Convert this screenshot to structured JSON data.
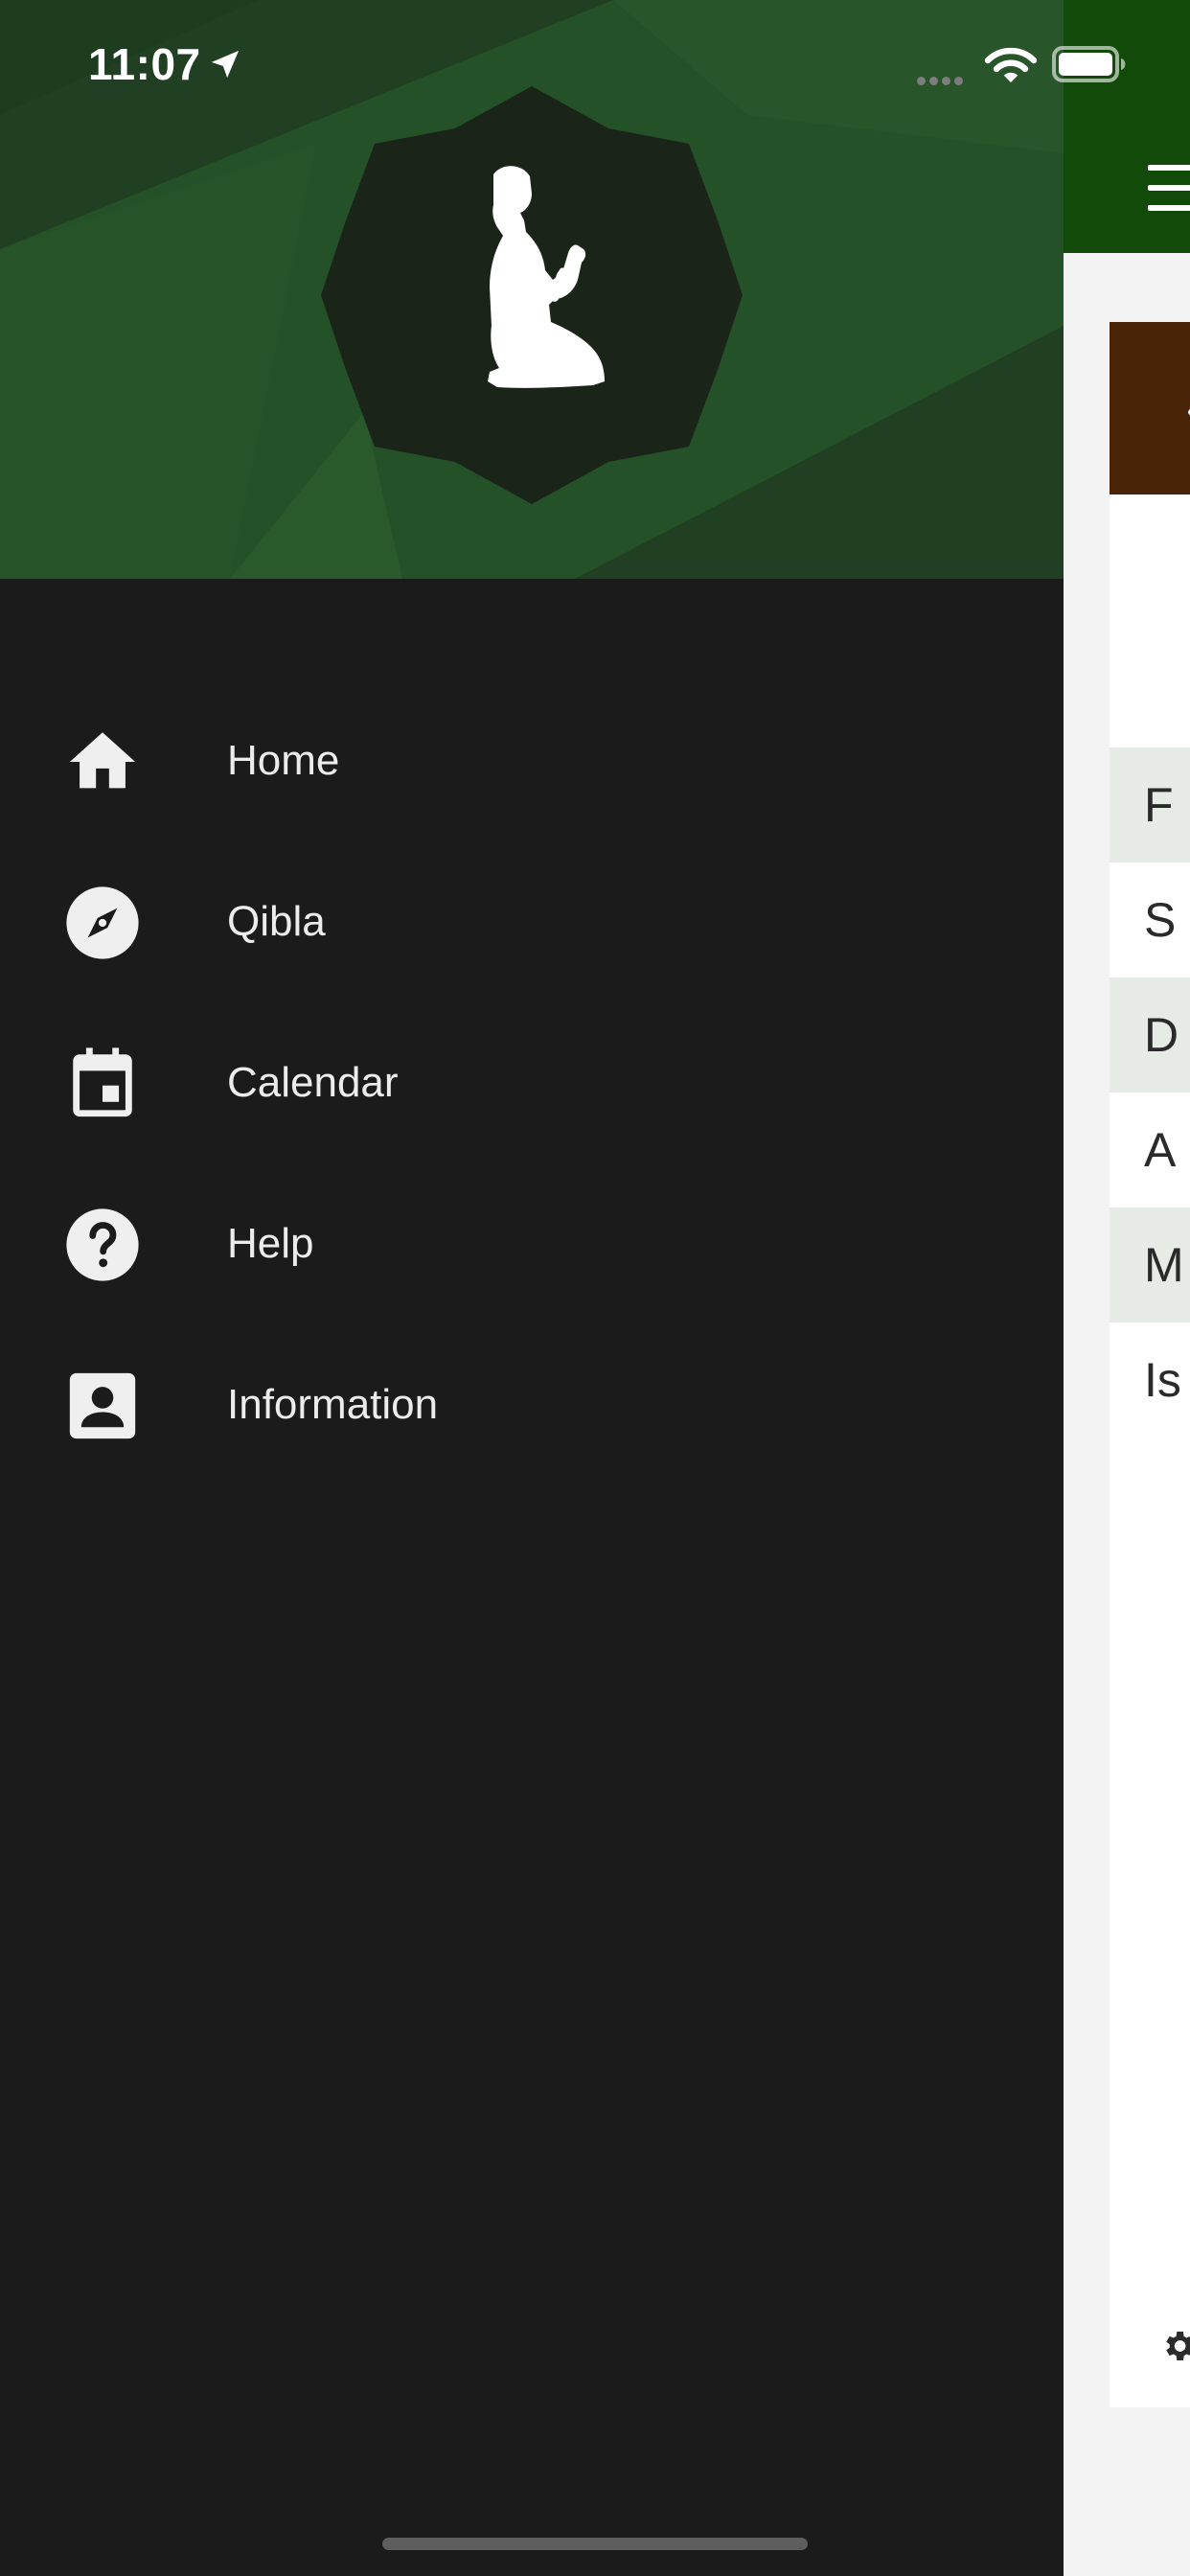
{
  "status_bar": {
    "time": "11:07",
    "location_icon": "location-arrow-icon",
    "wifi_icon": "wifi-icon",
    "battery_icon": "battery-full-icon"
  },
  "drawer": {
    "header_image": "praying-person-emblem",
    "menu": [
      {
        "label": "Home",
        "icon": "home-icon"
      },
      {
        "label": "Qibla",
        "icon": "compass-icon"
      },
      {
        "label": "Calendar",
        "icon": "calendar-icon"
      },
      {
        "label": "Help",
        "icon": "help-icon"
      },
      {
        "label": "Information",
        "icon": "contact-card-icon"
      }
    ]
  },
  "main_peek": {
    "menu_icon": "hamburger-menu-icon",
    "prev_icon": "chevron-left-icon",
    "prayer_rows": [
      "F",
      "S",
      "D",
      "A",
      "M",
      "Is"
    ],
    "settings_icon": "gear-icon"
  },
  "colors": {
    "drawer_bg": "#1b1b1b",
    "header_green": "#245127",
    "emblem_dark": "#1a2419",
    "app_bar_green": "#124a0a",
    "date_bar_brown": "#4a2408",
    "row_shade": "#e6ebe6",
    "icon_fill": "#efefef",
    "label_text": "#ececec"
  }
}
